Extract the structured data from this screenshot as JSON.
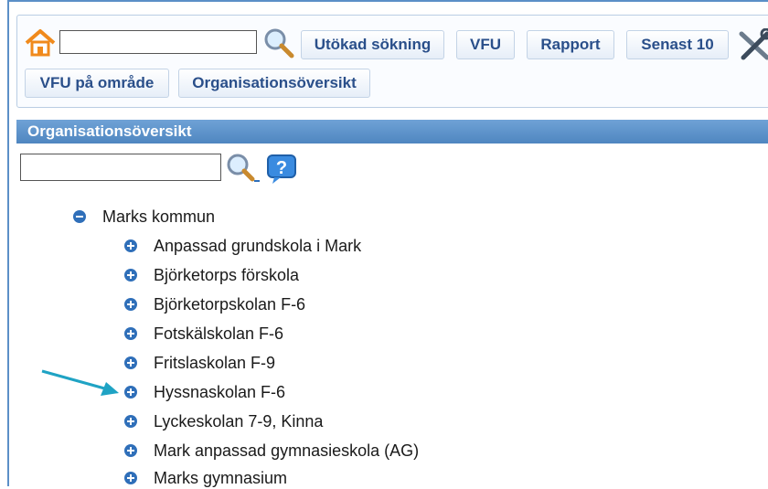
{
  "toolbar": {
    "search_value": "",
    "buttons": [
      "Utökad sökning",
      "VFU",
      "Rapport",
      "Senast 10",
      "VFU på område",
      "Organisationsöversikt"
    ]
  },
  "panel": {
    "title": "Organisationsöversikt",
    "search_value": ""
  },
  "tree": {
    "root": "Marks kommun",
    "children": [
      "Anpassad grundskola i Mark",
      "Björketorps förskola",
      "Björketorpskolan F-6",
      "Fotskälskolan F-6",
      "Fritslaskolan F-9",
      "Hyssnaskolan F-6",
      "Lyckeskolan 7-9, Kinna",
      "Mark anpassad gymnasieskola (AG)",
      "Marks gymnasium"
    ]
  },
  "colors": {
    "accent": "#2f6fb9",
    "header": "#4f86c0",
    "arrow": "#1fa3c4"
  }
}
